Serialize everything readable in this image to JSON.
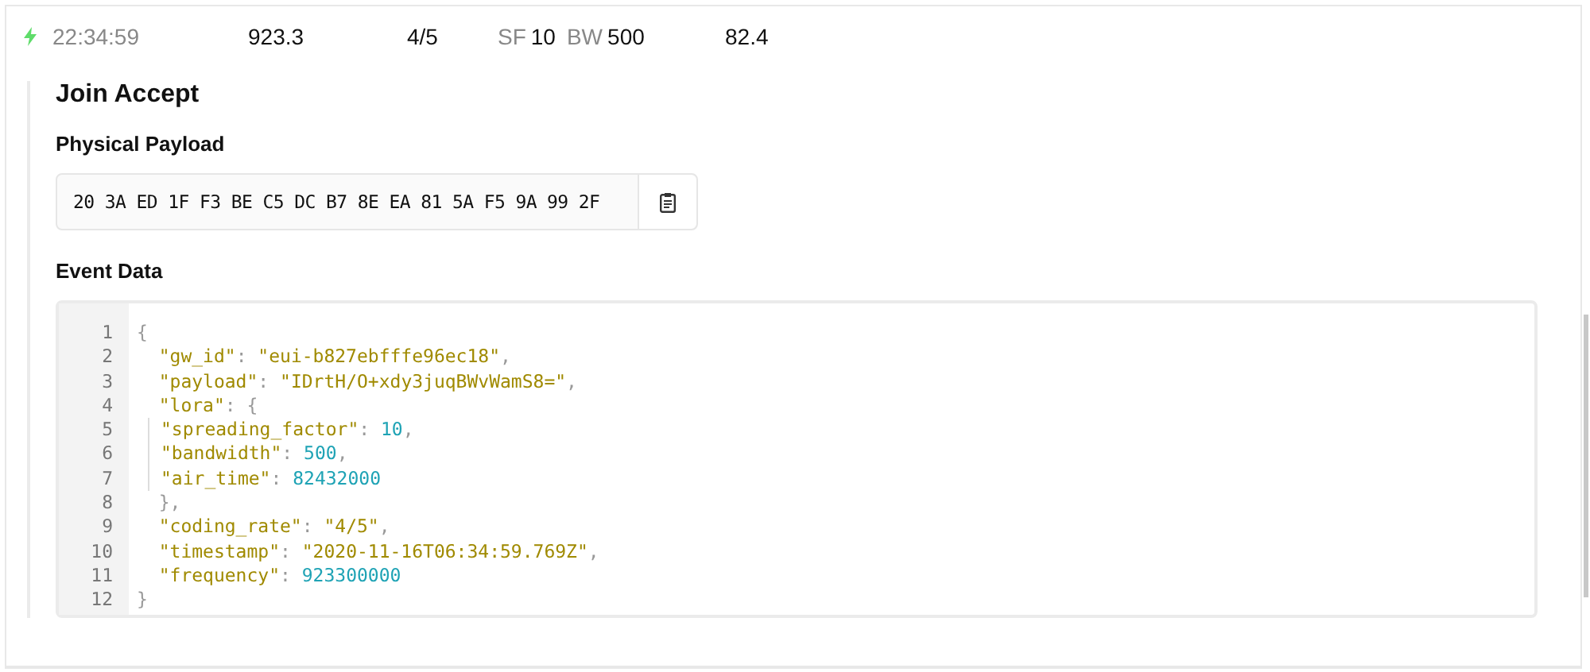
{
  "row": {
    "time": "22:34:59",
    "frequency": "923.3",
    "coding_rate": "4/5",
    "sf_label": "SF",
    "sf": "10",
    "bw_label": "BW",
    "bw": "500",
    "air_time": "82.4"
  },
  "detail": {
    "title": "Join Accept",
    "payload_heading": "Physical Payload",
    "payload": "20 3A ED 1F F3 BE C5 DC B7 8E EA 81 5A F5 9A 99 2F",
    "event_heading": "Event Data",
    "code": [
      {
        "number": "1",
        "guide": false,
        "tokens": [
          {
            "kind": "punct",
            "text": "{"
          }
        ]
      },
      {
        "number": "2",
        "guide": false,
        "tokens": [
          {
            "kind": "key",
            "text": "  \"gw_id\""
          },
          {
            "kind": "punct",
            "text": ": "
          },
          {
            "kind": "string",
            "text": "\"eui-b827ebfffe96ec18\""
          },
          {
            "kind": "punct",
            "text": ","
          }
        ]
      },
      {
        "number": "3",
        "guide": false,
        "tokens": [
          {
            "kind": "key",
            "text": "  \"payload\""
          },
          {
            "kind": "punct",
            "text": ": "
          },
          {
            "kind": "string",
            "text": "\"IDrtH/O+xdy3juqBWvWamS8=\""
          },
          {
            "kind": "punct",
            "text": ","
          }
        ]
      },
      {
        "number": "4",
        "guide": false,
        "tokens": [
          {
            "kind": "key",
            "text": "  \"lora\""
          },
          {
            "kind": "punct",
            "text": ": {"
          }
        ]
      },
      {
        "number": "5",
        "guide": true,
        "tokens": [
          {
            "kind": "key",
            "text": "\"spreading_factor\""
          },
          {
            "kind": "punct",
            "text": ": "
          },
          {
            "kind": "number",
            "text": "10"
          },
          {
            "kind": "punct",
            "text": ","
          }
        ]
      },
      {
        "number": "6",
        "guide": true,
        "tokens": [
          {
            "kind": "key",
            "text": "\"bandwidth\""
          },
          {
            "kind": "punct",
            "text": ": "
          },
          {
            "kind": "number",
            "text": "500"
          },
          {
            "kind": "punct",
            "text": ","
          }
        ]
      },
      {
        "number": "7",
        "guide": true,
        "tokens": [
          {
            "kind": "key",
            "text": "\"air_time\""
          },
          {
            "kind": "punct",
            "text": ": "
          },
          {
            "kind": "number",
            "text": "82432000"
          }
        ]
      },
      {
        "number": "8",
        "guide": false,
        "tokens": [
          {
            "kind": "punct",
            "text": "  },"
          }
        ]
      },
      {
        "number": "9",
        "guide": false,
        "tokens": [
          {
            "kind": "key",
            "text": "  \"coding_rate\""
          },
          {
            "kind": "punct",
            "text": ": "
          },
          {
            "kind": "string",
            "text": "\"4/5\""
          },
          {
            "kind": "punct",
            "text": ","
          }
        ]
      },
      {
        "number": "10",
        "guide": false,
        "tokens": [
          {
            "kind": "key",
            "text": "  \"timestamp\""
          },
          {
            "kind": "punct",
            "text": ": "
          },
          {
            "kind": "string",
            "text": "\"2020-11-16T06:34:59.769Z\""
          },
          {
            "kind": "punct",
            "text": ","
          }
        ]
      },
      {
        "number": "11",
        "guide": false,
        "tokens": [
          {
            "kind": "key",
            "text": "  \"frequency\""
          },
          {
            "kind": "punct",
            "text": ": "
          },
          {
            "kind": "number",
            "text": "923300000"
          }
        ]
      },
      {
        "number": "12",
        "guide": false,
        "tokens": [
          {
            "kind": "punct",
            "text": "}"
          }
        ]
      }
    ]
  }
}
